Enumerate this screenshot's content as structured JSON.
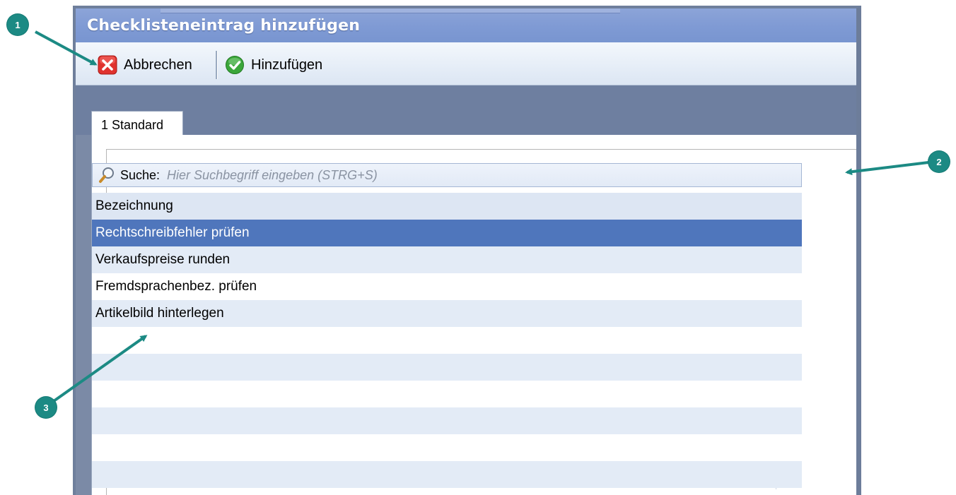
{
  "window": {
    "title": "Checklisteneintrag hinzufügen"
  },
  "toolbar": {
    "cancel_label": "Abbrechen",
    "add_label": "Hinzufügen"
  },
  "tabs": [
    {
      "label": "1 Standard",
      "active": true
    }
  ],
  "search": {
    "label": "Suche:",
    "placeholder": "Hier Suchbegriff eingeben (STRG+S)"
  },
  "grid": {
    "header": "Bezeichnung",
    "rows": [
      {
        "label": "Rechtschreibfehler prüfen",
        "selected": true
      },
      {
        "label": "Verkaufspreise runden",
        "selected": false
      },
      {
        "label": "Fremdsprachenbez. prüfen",
        "selected": false
      },
      {
        "label": "Artikelbild hinterlegen",
        "selected": false
      }
    ]
  },
  "callouts": [
    "1",
    "2",
    "3"
  ],
  "colors": {
    "accent": "#1c8a84",
    "selection": "#4f76bc",
    "titlebar": "#7f9ad4"
  }
}
